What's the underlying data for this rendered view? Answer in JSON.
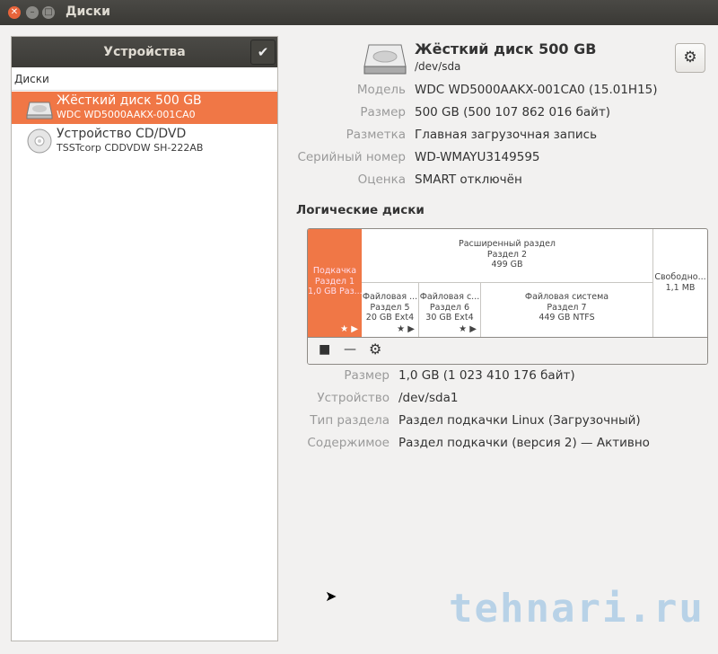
{
  "window": {
    "title": "Диски"
  },
  "sidebar": {
    "header": "Устройства",
    "section": "Диски",
    "devices": [
      {
        "name": "Жёсткий диск 500 GB",
        "model": "WDC WD5000AAKX-001CA0",
        "selected": true
      },
      {
        "name": "Устройство CD/DVD",
        "model": "TSSTcorp CDDVDW SH-222AB",
        "selected": false
      }
    ]
  },
  "disk": {
    "title": "Жёсткий диск 500 GB",
    "path": "/dev/sda",
    "props": [
      {
        "label": "Модель",
        "value": "WDC WD5000AAKX-001CA0 (15.01H15)"
      },
      {
        "label": "Размер",
        "value": "500 GB (500 107 862 016 байт)"
      },
      {
        "label": "Разметка",
        "value": "Главная загрузочная запись"
      },
      {
        "label": "Серийный номер",
        "value": "WD-WMAYU3149595"
      },
      {
        "label": "Оценка",
        "value": "SMART отключён"
      }
    ]
  },
  "volumes": {
    "header": "Логические диски",
    "swap": {
      "l1": "Подкачка",
      "l2": "Раздел 1",
      "l3": "1,0 GB Раз..."
    },
    "extended": {
      "l1": "Расширенный раздел",
      "l2": "Раздел 2",
      "l3": "499 GB"
    },
    "p5": {
      "l1": "Файловая ...",
      "l2": "Раздел 5",
      "l3": "20 GB Ext4"
    },
    "p6": {
      "l1": "Файловая с...",
      "l2": "Раздел 6",
      "l3": "30 GB Ext4"
    },
    "p7": {
      "l1": "Файловая система",
      "l2": "Раздел 7",
      "l3": "449 GB NTFS"
    },
    "free": {
      "l1": "Свободно...",
      "l2": "1,1 MB"
    },
    "accent": "#f07746"
  },
  "selected": {
    "props": [
      {
        "label": "Размер",
        "value": "1,0 GB (1 023 410 176 байт)"
      },
      {
        "label": "Устройство",
        "value": "/dev/sda1"
      },
      {
        "label": "Тип раздела",
        "value": "Раздел подкачки Linux (Загрузочный)"
      },
      {
        "label": "Содержимое",
        "value": "Раздел подкачки (версия 2) — Активно"
      }
    ]
  },
  "watermark": "tehnari.ru"
}
